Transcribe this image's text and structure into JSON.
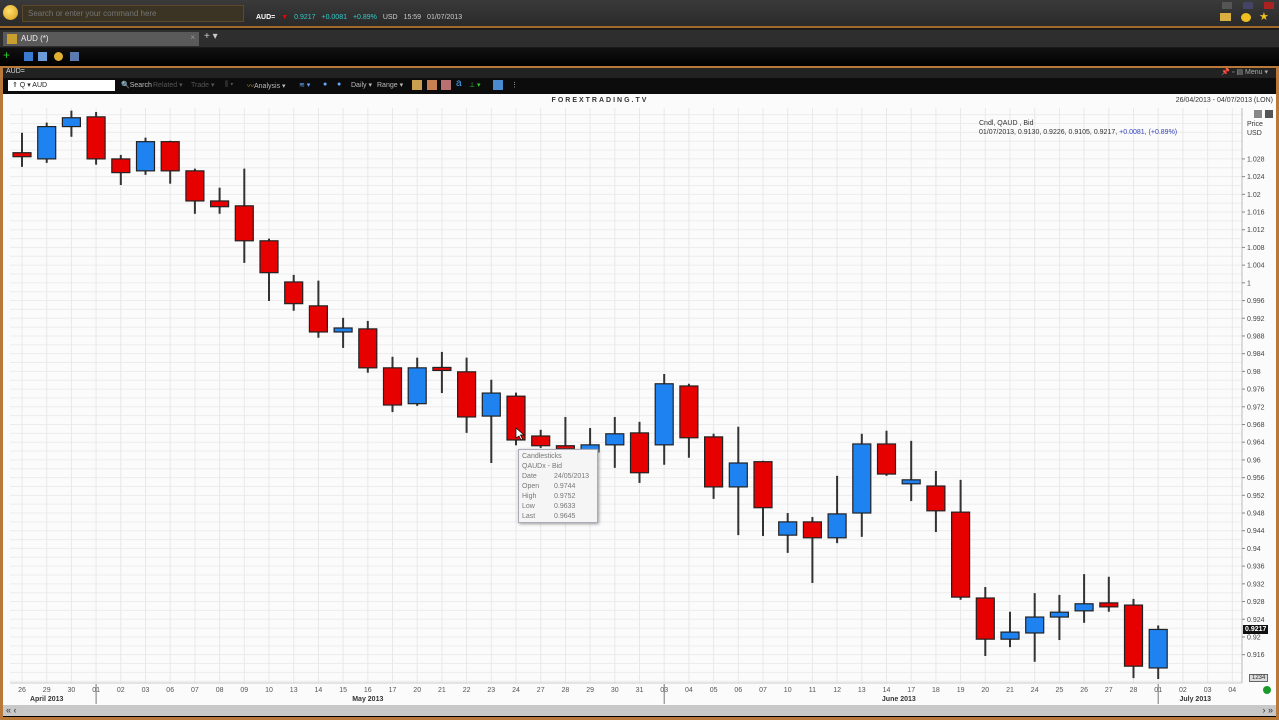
{
  "topbar": {
    "search_placeholder": "Search or enter your command here",
    "ric": "AUD=",
    "last": "0.9217",
    "change": "+0.0081",
    "pct": "+0.89%",
    "currency": "USD",
    "time": "15:59",
    "date": "01/07/2013"
  },
  "tab": {
    "label": "AUD (*)"
  },
  "chart_window": {
    "title": "AUD=",
    "menu_label": "Menu",
    "ric_input": "AUD",
    "ric_prefix": "⇑ Q",
    "toolbar": {
      "search": "Search",
      "related": "Related",
      "trade": "Trade",
      "analysis": "Analysis",
      "interval": "Daily",
      "range": "Range"
    }
  },
  "colors": {
    "up": "#1e82f0",
    "down": "#e60000",
    "accent": "#b8783a"
  },
  "chart_data": {
    "type": "candlestick",
    "title": "FOREXTRADING.TV",
    "date_range": "26/04/2013 - 04/07/2013 (LON)",
    "legend": {
      "line1": "Cndl, QAUD , Bid",
      "line2": "01/07/2013, 0.9130, 0.9226, 0.9105, 0.9217,",
      "change": "+0.0081, (+0.89%)"
    },
    "yaxis": {
      "title": "Price",
      "unit": "USD",
      "ylim": [
        0.9096,
        1.0395
      ],
      "ticks": [
        "1.028",
        "1.024",
        "1.02",
        "1.016",
        "1.012",
        "1.008",
        "1.004",
        "1",
        "0.996",
        "0.992",
        "0.988",
        "0.984",
        "0.98",
        "0.976",
        "0.972",
        "0.968",
        "0.964",
        "0.96",
        "0.956",
        "0.952",
        "0.948",
        "0.944",
        "0.94",
        "0.936",
        "0.932",
        "0.928",
        "0.924",
        "0.92",
        "0.916"
      ]
    },
    "last_price_tag": "0.9217",
    "page_box": "1234",
    "xaxis": {
      "days": [
        "26",
        "29",
        "30",
        "01",
        "02",
        "03",
        "06",
        "07",
        "08",
        "09",
        "10",
        "13",
        "14",
        "15",
        "16",
        "17",
        "20",
        "21",
        "22",
        "23",
        "24",
        "27",
        "28",
        "29",
        "30",
        "31",
        "03",
        "04",
        "05",
        "06",
        "07",
        "10",
        "11",
        "12",
        "13",
        "14",
        "17",
        "18",
        "19",
        "20",
        "21",
        "24",
        "25",
        "26",
        "27",
        "28",
        "01",
        "02",
        "03",
        "04"
      ],
      "months": [
        {
          "label": "April 2013",
          "from": 0,
          "to": 2
        },
        {
          "label": "May 2013",
          "from": 3,
          "to": 25
        },
        {
          "label": "June 2013",
          "from": 26,
          "to": 45
        },
        {
          "label": "July 2013",
          "from": 46,
          "to": 49
        }
      ],
      "separators": [
        3,
        26,
        46
      ]
    },
    "candles": [
      {
        "d": "26/04/2013",
        "o": 1.0294,
        "h": 1.0339,
        "l": 1.0262,
        "c": 1.0285
      },
      {
        "d": "29/04/2013",
        "o": 1.028,
        "h": 1.0362,
        "l": 1.0271,
        "c": 1.0353
      },
      {
        "d": "30/04/2013",
        "o": 1.0353,
        "h": 1.0389,
        "l": 1.033,
        "c": 1.0373
      },
      {
        "d": "01/05/2013",
        "o": 1.0375,
        "h": 1.0386,
        "l": 1.0267,
        "c": 1.028
      },
      {
        "d": "02/05/2013",
        "o": 1.028,
        "h": 1.0289,
        "l": 1.0221,
        "c": 1.0249
      },
      {
        "d": "03/05/2013",
        "o": 1.0253,
        "h": 1.0328,
        "l": 1.0244,
        "c": 1.0319
      },
      {
        "d": "06/05/2013",
        "o": 1.0319,
        "h": 1.0321,
        "l": 1.0224,
        "c": 1.0253
      },
      {
        "d": "07/05/2013",
        "o": 1.0253,
        "h": 1.0258,
        "l": 1.0156,
        "c": 1.0185
      },
      {
        "d": "08/05/2013",
        "o": 1.0185,
        "h": 1.0215,
        "l": 1.0156,
        "c": 1.0172
      },
      {
        "d": "09/05/2013",
        "o": 1.0174,
        "h": 1.0258,
        "l": 1.0045,
        "c": 1.0095
      },
      {
        "d": "10/05/2013",
        "o": 1.0095,
        "h": 1.01,
        "l": 0.9959,
        "c": 1.0023
      },
      {
        "d": "13/05/2013",
        "o": 1.0002,
        "h": 1.0018,
        "l": 0.9937,
        "c": 0.9953
      },
      {
        "d": "14/05/2013",
        "o": 0.9948,
        "h": 1.0005,
        "l": 0.9876,
        "c": 0.9889
      },
      {
        "d": "15/05/2013",
        "o": 0.9889,
        "h": 0.9921,
        "l": 0.9853,
        "c": 0.9898
      },
      {
        "d": "16/05/2013",
        "o": 0.9896,
        "h": 0.9914,
        "l": 0.9797,
        "c": 0.9808
      },
      {
        "d": "17/05/2013",
        "o": 0.9808,
        "h": 0.9833,
        "l": 0.9708,
        "c": 0.9724
      },
      {
        "d": "20/05/2013",
        "o": 0.9727,
        "h": 0.9831,
        "l": 0.9722,
        "c": 0.9808
      },
      {
        "d": "21/05/2013",
        "o": 0.9806,
        "h": 0.9844,
        "l": 0.9751,
        "c": 0.9805
      },
      {
        "d": "22/05/2013",
        "o": 0.9799,
        "h": 0.9831,
        "l": 0.9661,
        "c": 0.9697
      },
      {
        "d": "23/05/2013",
        "o": 0.9699,
        "h": 0.9781,
        "l": 0.9593,
        "c": 0.9751
      },
      {
        "d": "24/05/2013",
        "o": 0.9744,
        "h": 0.9752,
        "l": 0.9633,
        "c": 0.9645
      },
      {
        "d": "27/05/2013",
        "o": 0.9654,
        "h": 0.9668,
        "l": 0.9627,
        "c": 0.9632
      },
      {
        "d": "28/05/2013",
        "o": 0.9632,
        "h": 0.9697,
        "l": 0.9612,
        "c": 0.9625
      },
      {
        "d": "29/05/2013",
        "o": 0.9618,
        "h": 0.9672,
        "l": 0.9596,
        "c": 0.9634
      },
      {
        "d": "30/05/2013",
        "o": 0.9634,
        "h": 0.9697,
        "l": 0.9582,
        "c": 0.9659
      },
      {
        "d": "31/05/2013",
        "o": 0.9661,
        "h": 0.9686,
        "l": 0.9548,
        "c": 0.9571
      },
      {
        "d": "03/06/2013",
        "o": 0.9634,
        "h": 0.9794,
        "l": 0.9589,
        "c": 0.9772
      },
      {
        "d": "04/06/2013",
        "o": 0.9767,
        "h": 0.9772,
        "l": 0.9605,
        "c": 0.965
      },
      {
        "d": "05/06/2013",
        "o": 0.9652,
        "h": 0.9659,
        "l": 0.9512,
        "c": 0.9539
      },
      {
        "d": "06/06/2013",
        "o": 0.9539,
        "h": 0.9675,
        "l": 0.943,
        "c": 0.9593
      },
      {
        "d": "07/06/2013",
        "o": 0.9596,
        "h": 0.9598,
        "l": 0.9428,
        "c": 0.9492
      },
      {
        "d": "10/06/2013",
        "o": 0.943,
        "h": 0.948,
        "l": 0.939,
        "c": 0.946
      },
      {
        "d": "11/06/2013",
        "o": 0.946,
        "h": 0.9471,
        "l": 0.9322,
        "c": 0.9424
      },
      {
        "d": "12/06/2013",
        "o": 0.9424,
        "h": 0.9564,
        "l": 0.9412,
        "c": 0.9478
      },
      {
        "d": "13/06/2013",
        "o": 0.948,
        "h": 0.9659,
        "l": 0.9426,
        "c": 0.9636
      },
      {
        "d": "14/06/2013",
        "o": 0.9636,
        "h": 0.9666,
        "l": 0.9564,
        "c": 0.9568
      },
      {
        "d": "17/06/2013",
        "o": 0.9546,
        "h": 0.9643,
        "l": 0.9507,
        "c": 0.9555
      },
      {
        "d": "18/06/2013",
        "o": 0.9541,
        "h": 0.9575,
        "l": 0.9437,
        "c": 0.9485
      },
      {
        "d": "19/06/2013",
        "o": 0.9482,
        "h": 0.9555,
        "l": 0.9284,
        "c": 0.929
      },
      {
        "d": "20/06/2013",
        "o": 0.9288,
        "h": 0.9313,
        "l": 0.9157,
        "c": 0.9195
      },
      {
        "d": "21/06/2013",
        "o": 0.9195,
        "h": 0.9257,
        "l": 0.9177,
        "c": 0.9211
      },
      {
        "d": "24/06/2013",
        "o": 0.9209,
        "h": 0.9299,
        "l": 0.9144,
        "c": 0.9245
      },
      {
        "d": "25/06/2013",
        "o": 0.9245,
        "h": 0.9295,
        "l": 0.9193,
        "c": 0.9256
      },
      {
        "d": "26/06/2013",
        "o": 0.9259,
        "h": 0.9342,
        "l": 0.9232,
        "c": 0.9275
      },
      {
        "d": "27/06/2013",
        "o": 0.9277,
        "h": 0.9336,
        "l": 0.9257,
        "c": 0.9268
      },
      {
        "d": "28/06/2013",
        "o": 0.9272,
        "h": 0.9286,
        "l": 0.9107,
        "c": 0.9134
      },
      {
        "d": "01/07/2013",
        "o": 0.913,
        "h": 0.9226,
        "l": 0.9105,
        "c": 0.9217
      }
    ],
    "tooltip": {
      "title": "Candlesticks",
      "series": "QAUDx - Bid",
      "rows": [
        {
          "k": "Date",
          "v": "24/05/2013"
        },
        {
          "k": "Open",
          "v": "0.9744"
        },
        {
          "k": "High",
          "v": "0.9752"
        },
        {
          "k": "Low",
          "v": "0.9633"
        },
        {
          "k": "Last",
          "v": "0.9645"
        }
      ]
    }
  }
}
